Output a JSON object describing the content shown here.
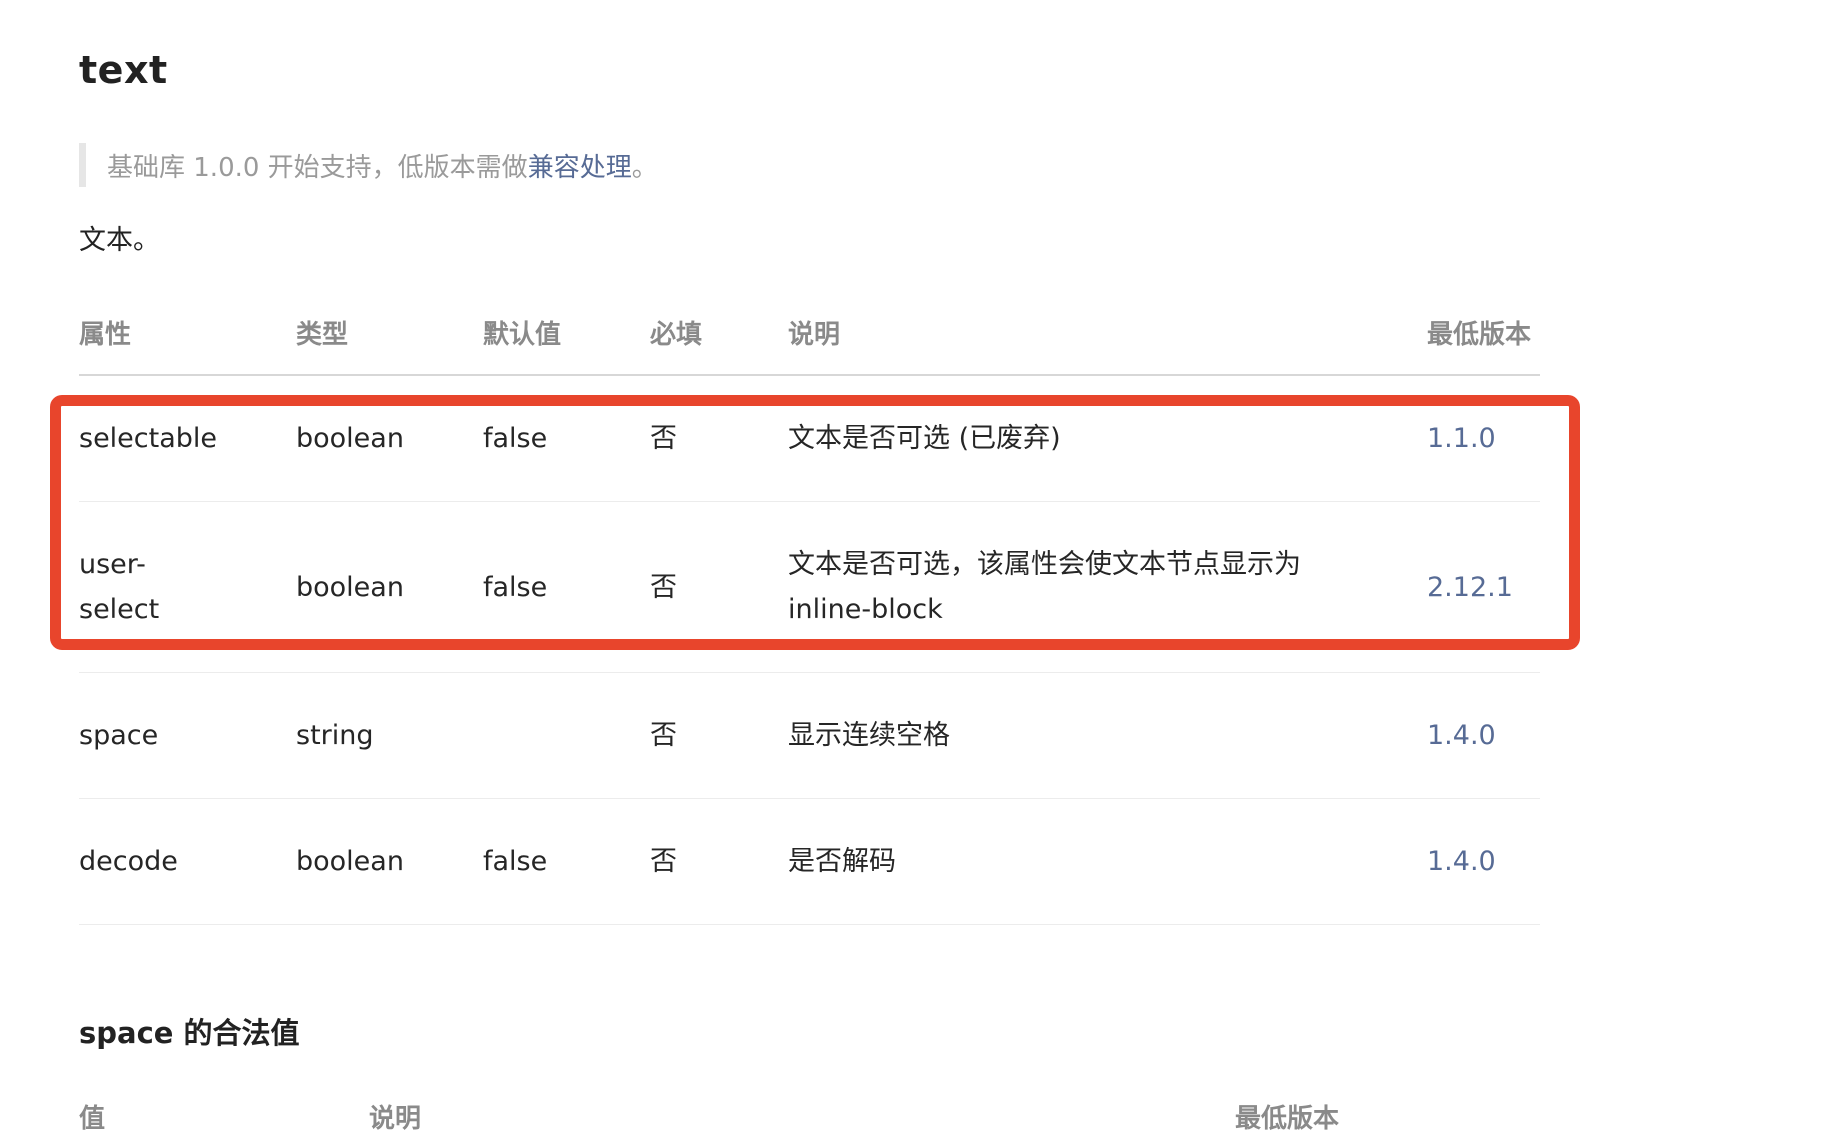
{
  "title": "text",
  "notice": {
    "prefix": "基础库 1.0.0 开始支持，低版本需做",
    "link": "兼容处理",
    "suffix": "。"
  },
  "description": "文本。",
  "table": {
    "headers": {
      "attr": "属性",
      "type": "类型",
      "default": "默认值",
      "required": "必填",
      "desc": "说明",
      "version": "最低版本"
    },
    "rows": [
      {
        "attr": "selectable",
        "type": "boolean",
        "default": "false",
        "required": "否",
        "desc": "文本是否可选 (已废弃)",
        "version": "1.1.0"
      },
      {
        "attr": "user-select",
        "type": "boolean",
        "default": "false",
        "required": "否",
        "desc": "文本是否可选，该属性会使文本节点显示为 inline-block",
        "version": "2.12.1"
      },
      {
        "attr": "space",
        "type": "string",
        "default": "",
        "required": "否",
        "desc": "显示连续空格",
        "version": "1.4.0"
      },
      {
        "attr": "decode",
        "type": "boolean",
        "default": "false",
        "required": "否",
        "desc": "是否解码",
        "version": "1.4.0"
      }
    ]
  },
  "annotation": {
    "color": "#e8452c"
  },
  "space_section": {
    "title": "space 的合法值",
    "headers": {
      "value": "值",
      "desc": "说明",
      "version": "最低版本"
    }
  },
  "colors": {
    "link": "#576b95",
    "muted": "#9a9a9a",
    "highlight": "#e8452c"
  }
}
